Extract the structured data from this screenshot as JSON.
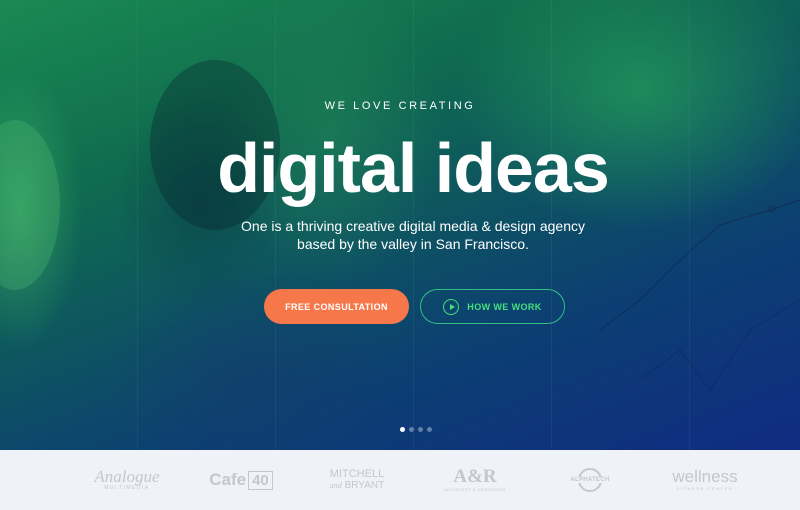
{
  "hero": {
    "eyebrow": "WE LOVE CREATING",
    "headline": "digital ideas",
    "subtitle_lines": [
      "One is a thriving creative digital media & design agency",
      "based by the valley in San Francisco."
    ],
    "primary_button": "FREE CONSULTATION",
    "secondary_button": "HOW WE WORK",
    "slide_count": 4,
    "active_slide": 1,
    "colors": {
      "gradient_green": "#1a8a52",
      "gradient_blue": "#102b82",
      "primary_button": "#f6784a",
      "secondary_accent": "#46e07e"
    },
    "icons": [
      "play-icon"
    ]
  },
  "logos": [
    {
      "name": "Analogue",
      "sub": "MULTIMEDIA"
    },
    {
      "name": "Cafe",
      "badge": "40"
    },
    {
      "name": "MITCHELL",
      "sub_lines": [
        "and",
        "BRYANT"
      ]
    },
    {
      "name": "A&R",
      "sub": "ARCHITECT & DESIGNERS"
    },
    {
      "name": "ALPHATECH"
    },
    {
      "name": "wellness",
      "sub": "FITNESS CENTER"
    }
  ]
}
